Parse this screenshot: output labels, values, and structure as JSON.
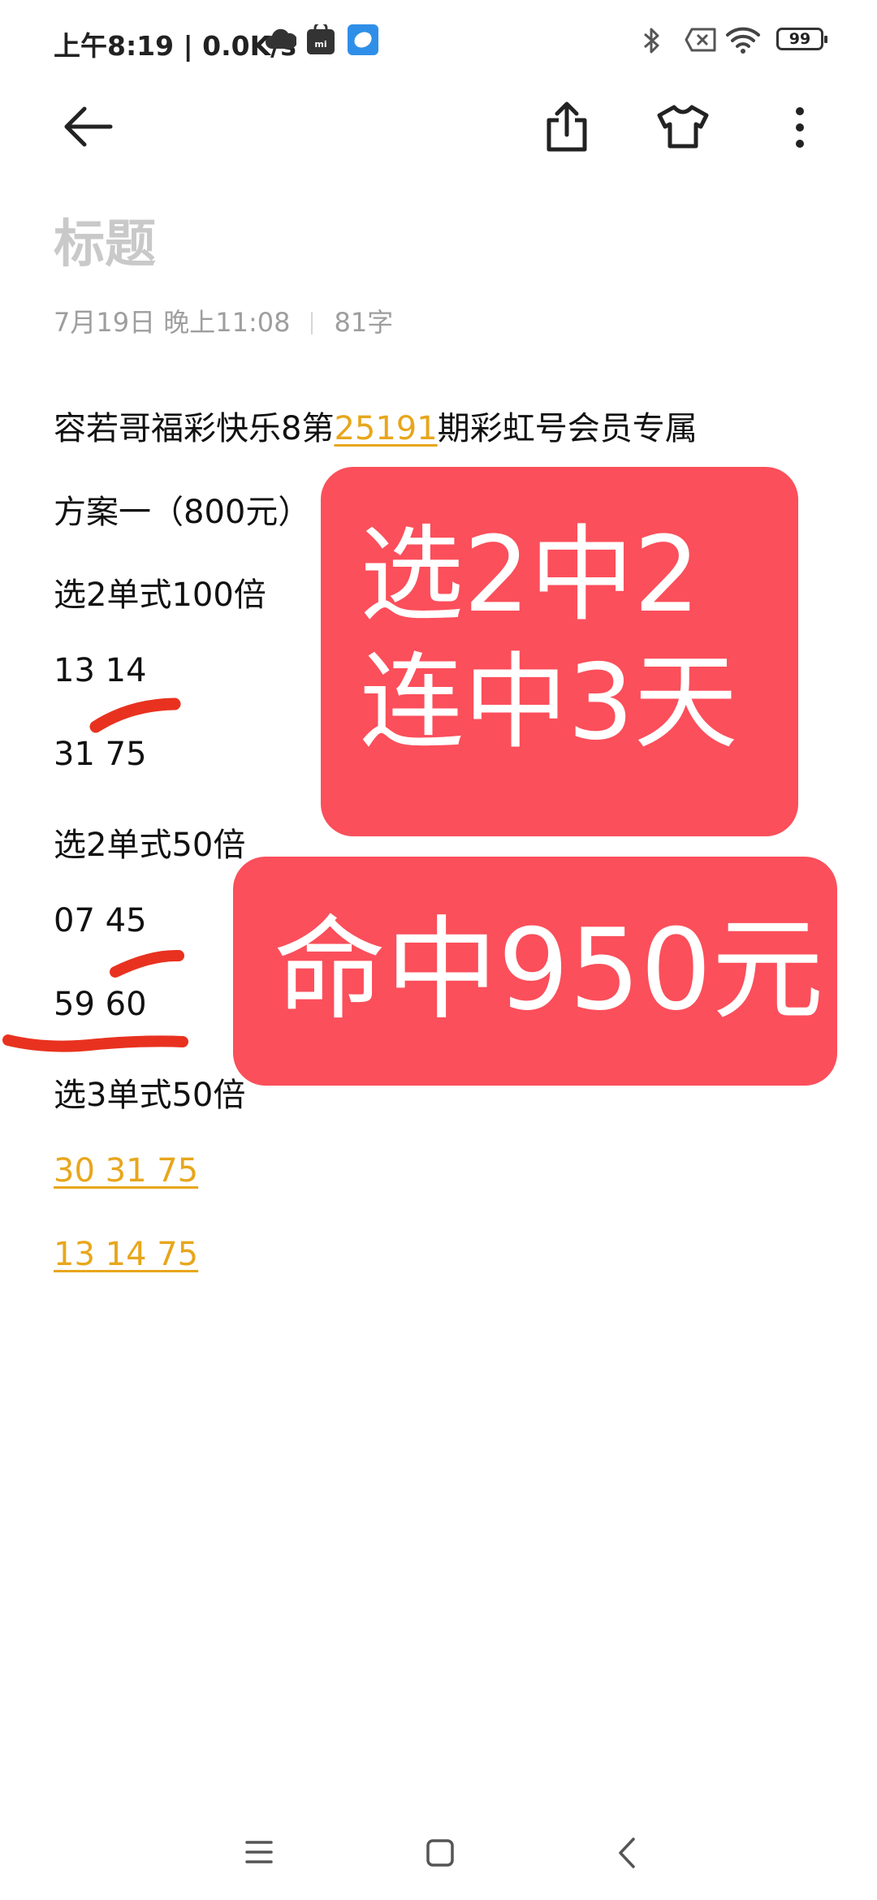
{
  "status_bar": {
    "time": "上午8:19 | 0.0K/s",
    "battery": "99",
    "icons": [
      "cloud-icon",
      "mi-store-icon",
      "app-icon",
      "bluetooth-icon",
      "no-sim-icon",
      "wifi-icon",
      "battery-icon"
    ]
  },
  "toolbar": {
    "icons": [
      "back-arrow-icon",
      "share-icon",
      "theme-shirt-icon",
      "more-vertical-icon"
    ]
  },
  "note": {
    "title": "标题",
    "date": "7月19日  晚上11:08",
    "char_count": "81字",
    "line1_prefix": "容若哥福彩快乐8第",
    "line1_link": "25191",
    "line1_suffix": "期彩虹号会员专属",
    "line2": "方案一（800元）",
    "line3": "选2单式100倍",
    "line4": "13 14",
    "line5": "31 75",
    "line6": "选2单式50倍",
    "line7": "07 45",
    "line8": "59 60",
    "line9": "选3单式50倍",
    "line10": "30 31 75",
    "line11": "13 14 75"
  },
  "overlays": {
    "banner1_line1": "选2中2",
    "banner1_line2": "连中3天",
    "banner2": "命中950元",
    "accent_color": "#fb4f5b"
  },
  "nav_bar": {
    "icons": [
      "menu-icon",
      "home-square-icon",
      "back-chevron-icon"
    ]
  },
  "colors": {
    "link": "#e8a61c",
    "title_placeholder": "#c9c9c9",
    "meta": "#9e9e9e",
    "scribble": "#e8321f"
  }
}
